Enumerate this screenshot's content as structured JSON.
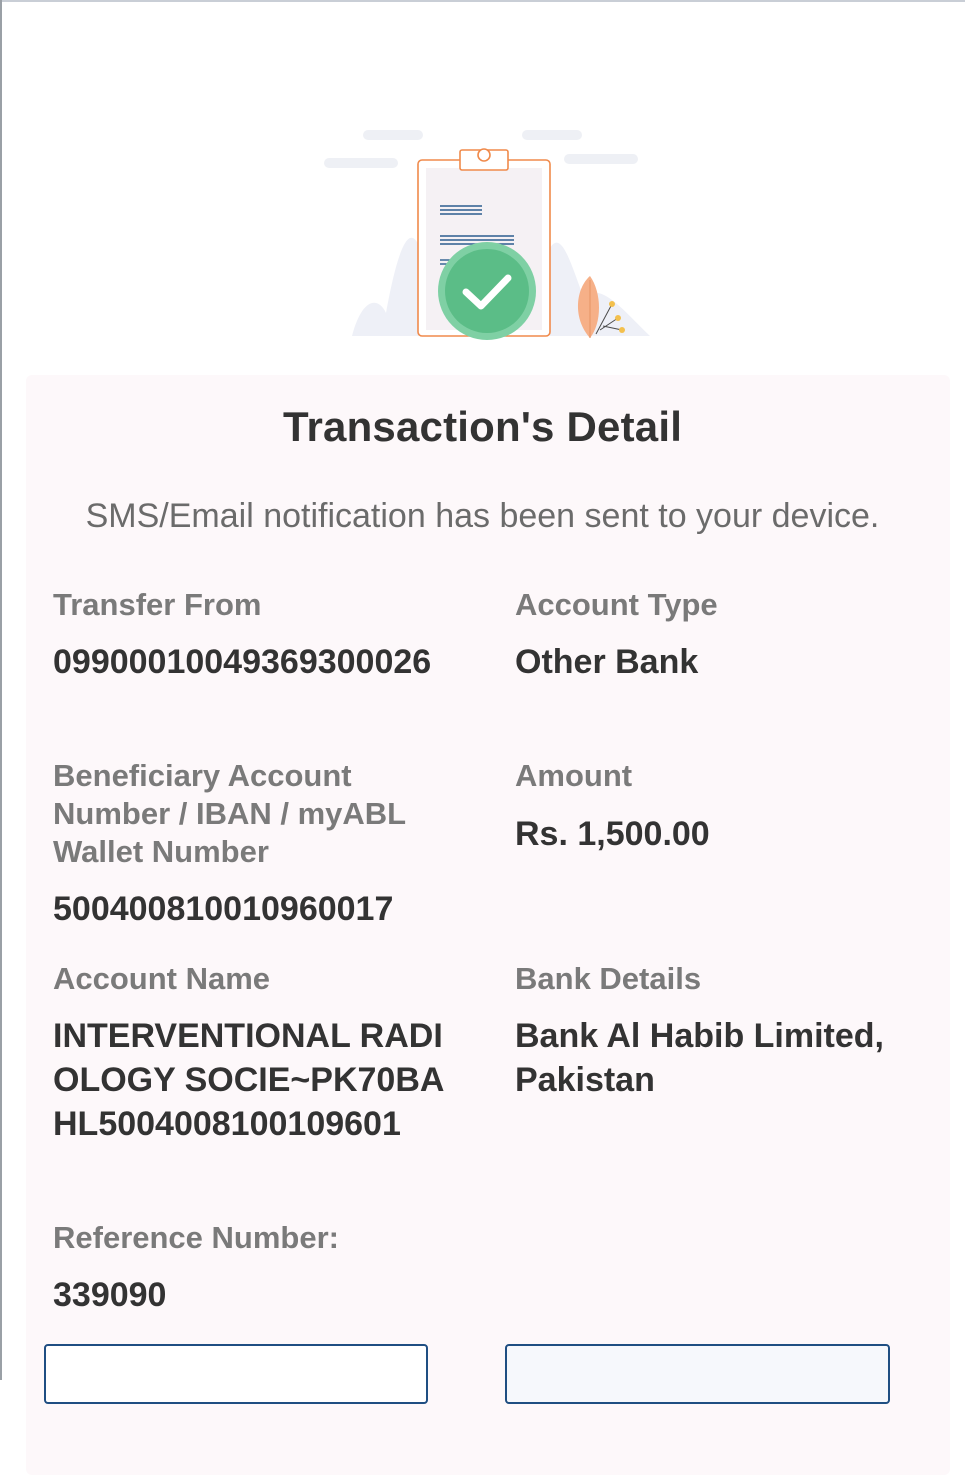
{
  "header": {
    "title": "Transaction's Detail",
    "notice": "SMS/Email notification has been sent to your device."
  },
  "details": {
    "transfer_from": {
      "label": "Transfer From",
      "value": "09900010049369300026"
    },
    "account_type": {
      "label": "Account Type",
      "value": "Other Bank"
    },
    "beneficiary": {
      "label": "Beneficiary Account Number / IBAN / myABL Wallet Number",
      "value": "500400810010960017"
    },
    "amount": {
      "label": "Amount",
      "value": "Rs. 1,500.00"
    },
    "account_name": {
      "label": "Account Name",
      "value": "INTERVENTIONAL RADIOLOGY SOCIE~PK70BAHL5004008100109601"
    },
    "bank_details": {
      "label": "Bank Details",
      "value": "Bank Al Habib Limited, Pakistan"
    },
    "reference": {
      "label": "Reference Number:",
      "value": "339090"
    }
  },
  "icons": {
    "hero": "clipboard-success-illustration",
    "check": "check-circle-icon"
  },
  "colors": {
    "success": "#5bbd87",
    "clipboard_border": "#f08a4b",
    "card_bg": "#fdf8fa",
    "button_border": "#1f4e82"
  }
}
